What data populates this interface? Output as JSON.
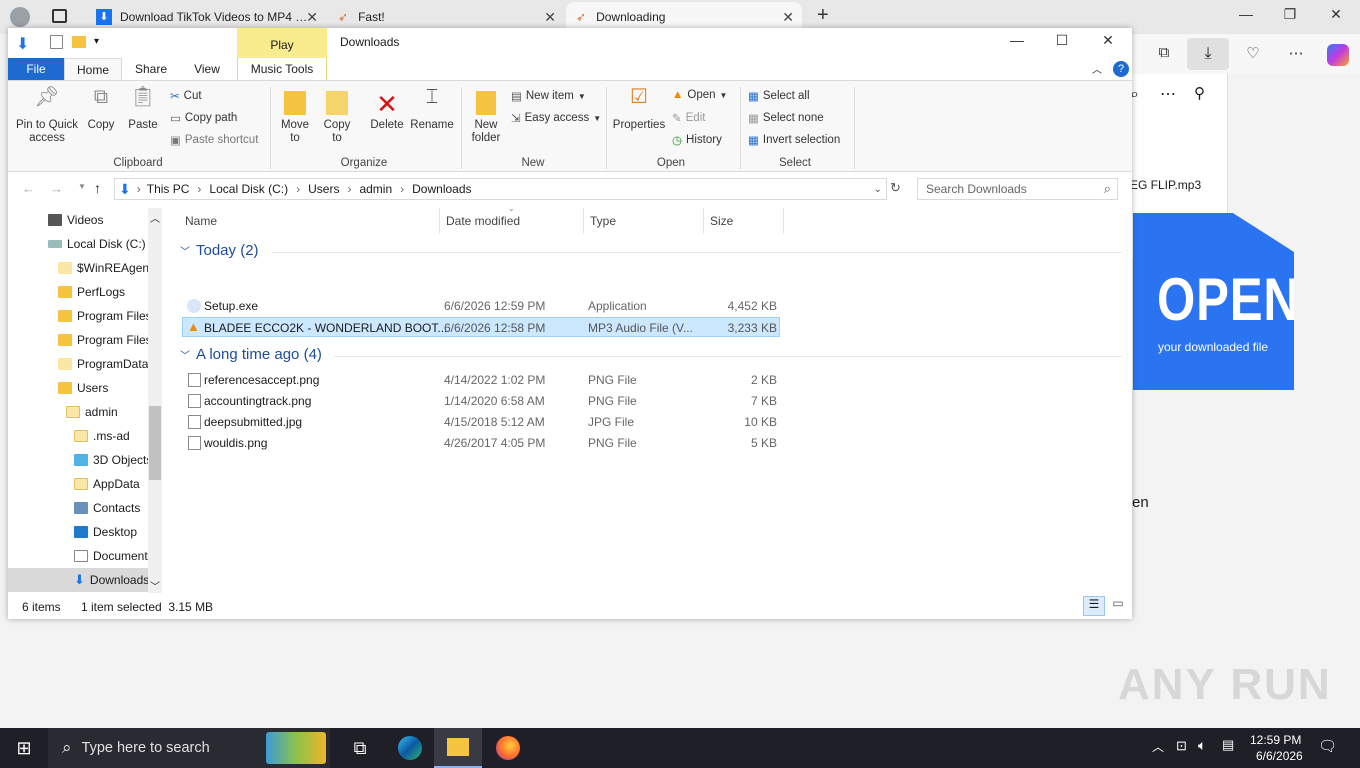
{
  "browser": {
    "tabs": [
      {
        "title": "Download TikTok Videos to MP4 …"
      },
      {
        "title": "Fast!"
      },
      {
        "title": "Downloading"
      }
    ],
    "new_tab": "+",
    "banner_big": "OPEN",
    "banner_small": "your downloaded file",
    "dl_file": "EG FLIP.mp3",
    "fragment": "en",
    "watermark": "ANY RUN"
  },
  "explorer": {
    "title": "Downloads",
    "context_tab": "Play",
    "tabs": [
      "File",
      "Home",
      "Share",
      "View",
      "Music Tools"
    ],
    "clipboard": {
      "pin": "Pin to Quick access",
      "copy": "Copy",
      "paste": "Paste",
      "cut": "Cut",
      "copy_path": "Copy path",
      "paste_shortcut": "Paste shortcut",
      "label": "Clipboard"
    },
    "organize": {
      "move_to": "Move to",
      "copy_to": "Copy to",
      "delete": "Delete",
      "rename": "Rename",
      "label": "Organize"
    },
    "new": {
      "new_folder": "New folder",
      "new_item": "New item",
      "easy_access": "Easy access",
      "label": "New"
    },
    "open": {
      "properties": "Properties",
      "open": "Open",
      "edit": "Edit",
      "history": "History",
      "label": "Open"
    },
    "select": {
      "select_all": "Select all",
      "select_none": "Select none",
      "invert": "Invert selection",
      "label": "Select"
    },
    "breadcrumb": [
      "This PC",
      "Local Disk (C:)",
      "Users",
      "admin",
      "Downloads"
    ],
    "search_placeholder": "Search Downloads",
    "nav": [
      {
        "label": "Videos"
      },
      {
        "label": "Local Disk (C:)"
      },
      {
        "label": "$WinREAgent"
      },
      {
        "label": "PerfLogs"
      },
      {
        "label": "Program Files"
      },
      {
        "label": "Program Files"
      },
      {
        "label": "ProgramData"
      },
      {
        "label": "Users"
      },
      {
        "label": "admin"
      },
      {
        "label": ".ms-ad"
      },
      {
        "label": "3D Objects"
      },
      {
        "label": "AppData"
      },
      {
        "label": "Contacts"
      },
      {
        "label": "Desktop"
      },
      {
        "label": "Documents"
      },
      {
        "label": "Downloads"
      }
    ],
    "columns": {
      "name": "Name",
      "date": "Date modified",
      "type": "Type",
      "size": "Size"
    },
    "groups": [
      {
        "label": "Today (2)",
        "files": [
          {
            "name": "Setup.exe",
            "date": "6/6/2026 12:59 PM",
            "type": "Application",
            "size": "4,452 KB"
          },
          {
            "name": "BLADEE  ECCO2K - WONDERLAND BOOT...",
            "date": "6/6/2026 12:58 PM",
            "type": "MP3 Audio File (V...",
            "size": "3,233 KB"
          }
        ]
      },
      {
        "label": "A long time ago (4)",
        "files": [
          {
            "name": "referencesaccept.png",
            "date": "4/14/2022 1:02 PM",
            "type": "PNG File",
            "size": "2 KB"
          },
          {
            "name": "accountingtrack.png",
            "date": "1/14/2020 6:58 AM",
            "type": "PNG File",
            "size": "7 KB"
          },
          {
            "name": "deepsubmitted.jpg",
            "date": "4/15/2018 5:12 AM",
            "type": "JPG File",
            "size": "10 KB"
          },
          {
            "name": "wouldis.png",
            "date": "4/26/2017 4:05 PM",
            "type": "PNG File",
            "size": "5 KB"
          }
        ]
      }
    ],
    "status": {
      "items": "6 items",
      "selected": "1 item selected  3.15 MB"
    }
  },
  "taskbar": {
    "search_placeholder": "Type here to search",
    "time": "12:59 PM",
    "date": "6/6/2026"
  }
}
